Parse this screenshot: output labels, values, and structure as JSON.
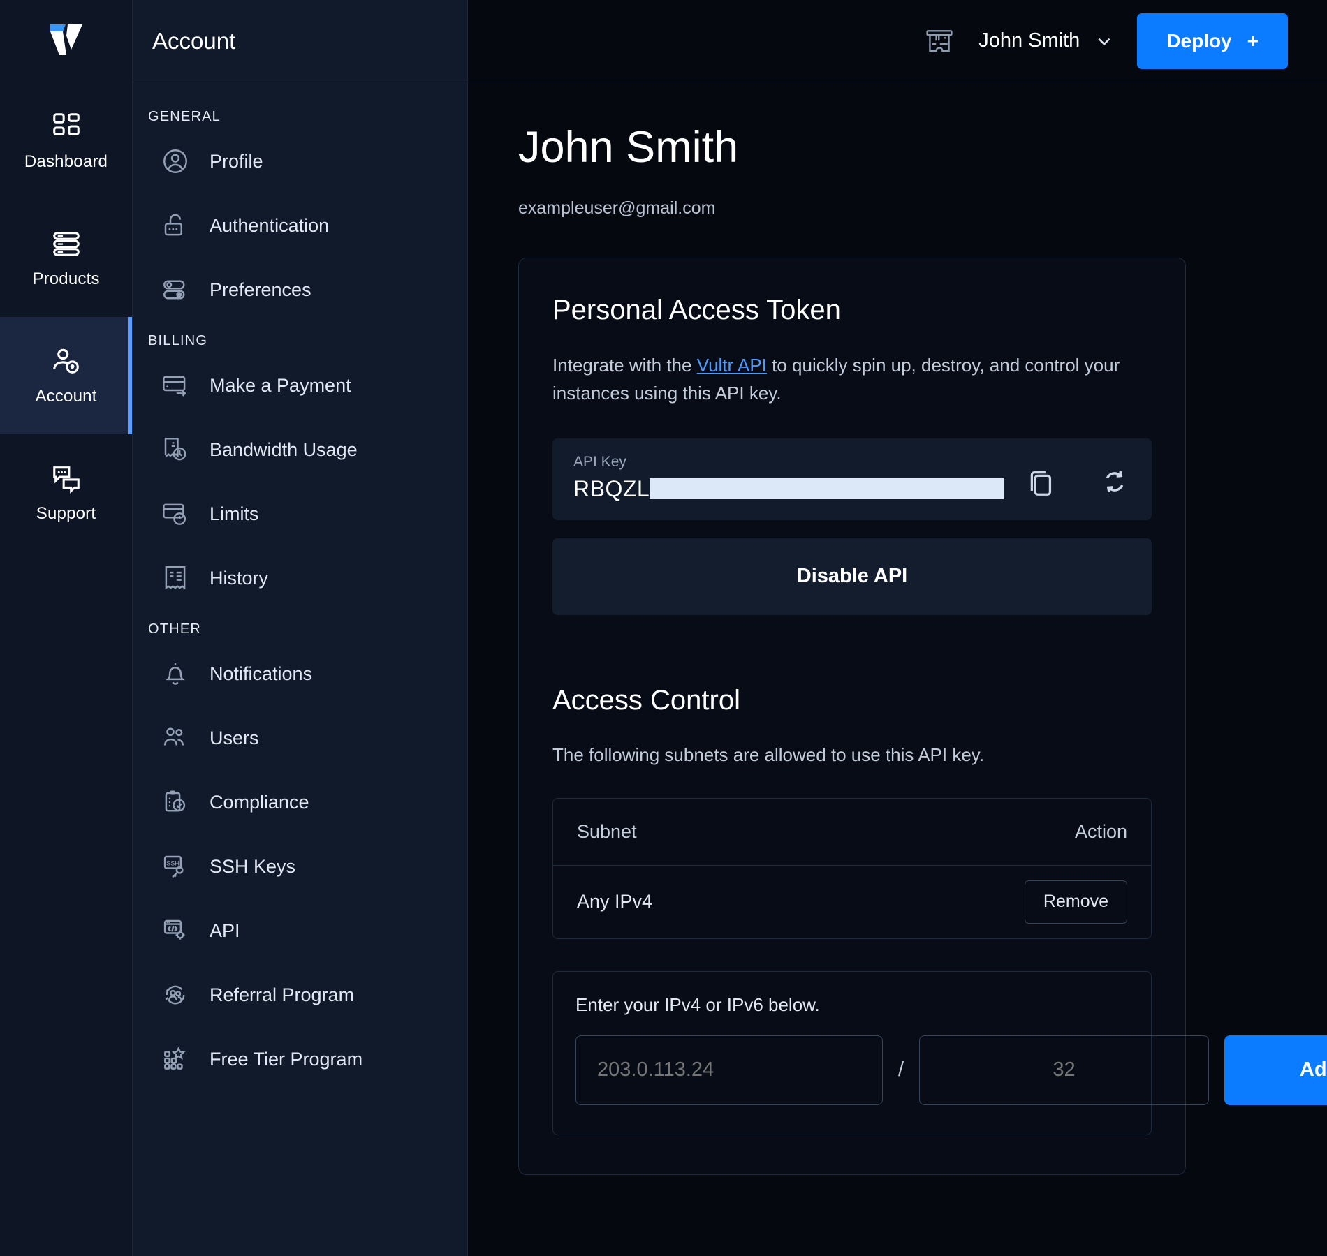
{
  "brand": {
    "logo_name": "vultr-logo",
    "accent": "#0b7bff",
    "active_bar": "#5b9dff"
  },
  "rail": {
    "items": [
      {
        "label": "Dashboard",
        "icon": "dashboard-grid-icon",
        "active": false
      },
      {
        "label": "Products",
        "icon": "servers-stack-icon",
        "active": false
      },
      {
        "label": "Account",
        "icon": "user-badge-icon",
        "active": true
      },
      {
        "label": "Support",
        "icon": "chat-bubbles-icon",
        "active": false
      }
    ]
  },
  "sidebar": {
    "title": "Account",
    "groups": [
      {
        "label": "GENERAL",
        "items": [
          {
            "label": "Profile",
            "icon": "user-circle-icon"
          },
          {
            "label": "Authentication",
            "icon": "unlocked-padlock-icon"
          },
          {
            "label": "Preferences",
            "icon": "toggles-icon"
          }
        ]
      },
      {
        "label": "BILLING",
        "items": [
          {
            "label": "Make a Payment",
            "icon": "credit-card-arrow-icon"
          },
          {
            "label": "Bandwidth Usage",
            "icon": "bill-gauge-icon"
          },
          {
            "label": "Limits",
            "icon": "card-alert-icon"
          },
          {
            "label": "History",
            "icon": "receipt-icon"
          }
        ]
      },
      {
        "label": "OTHER",
        "items": [
          {
            "label": "Notifications",
            "icon": "bell-icon"
          },
          {
            "label": "Users",
            "icon": "users-group-icon"
          },
          {
            "label": "Compliance",
            "icon": "clipboard-check-icon"
          },
          {
            "label": "SSH Keys",
            "icon": "ssh-key-icon"
          },
          {
            "label": "API",
            "icon": "code-window-gear-icon"
          },
          {
            "label": "Referral Program",
            "icon": "referral-people-icon"
          },
          {
            "label": "Free Tier Program",
            "icon": "grid-star-icon"
          }
        ]
      }
    ]
  },
  "topbar": {
    "ticket_icon": "ticket-icon",
    "user_name": "John Smith",
    "chevron_icon": "chevron-down-icon",
    "deploy_label": "Deploy",
    "deploy_plus": "+"
  },
  "page": {
    "title": "John Smith",
    "email": "exampleuser@gmail.com"
  },
  "token_card": {
    "heading": "Personal Access Token",
    "desc_before": "Integrate with the ",
    "desc_link": "Vultr API",
    "desc_after": " to quickly spin up, destroy, and control your instances using this API key.",
    "api_key_label": "API Key",
    "api_key_visible": "RBQZL",
    "copy_icon": "copy-icon",
    "refresh_icon": "refresh-icon",
    "disable_label": "Disable API"
  },
  "access_control": {
    "heading": "Access Control",
    "description": "The following subnets are allowed to use this API key.",
    "columns": {
      "subnet": "Subnet",
      "action": "Action"
    },
    "rows": [
      {
        "subnet": "Any IPv4",
        "action_label": "Remove"
      }
    ],
    "add_form": {
      "label": "Enter your IPv4 or IPv6 below.",
      "ip_placeholder": "203.0.113.24",
      "ip_value": "",
      "separator": "/",
      "cidr_placeholder": "32",
      "cidr_value": "",
      "add_label": "Add"
    }
  }
}
